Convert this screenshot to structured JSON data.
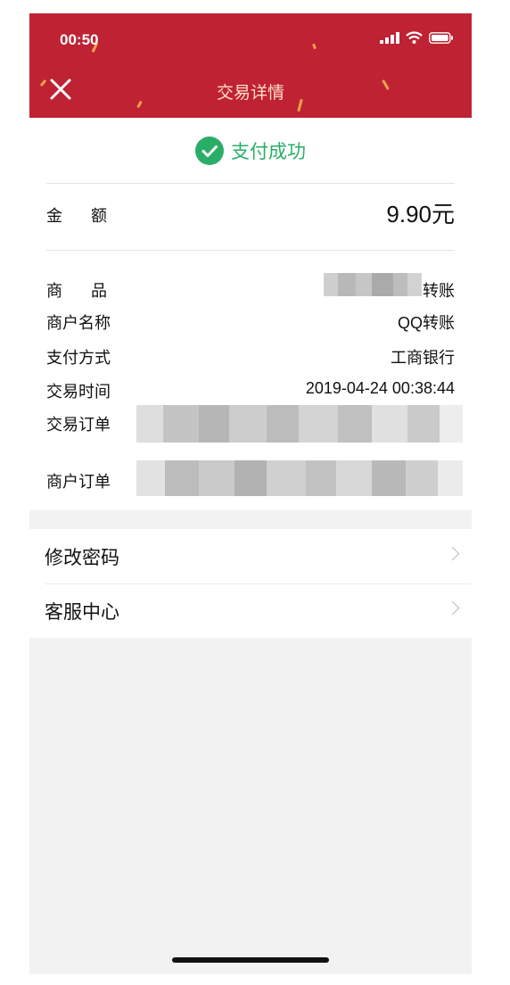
{
  "status_bar": {
    "time": "00:50"
  },
  "nav": {
    "title": "交易详情"
  },
  "status": {
    "text": "支付成功"
  },
  "amount": {
    "label": "金额",
    "value": "9.90元"
  },
  "details": {
    "product": {
      "label": "商品",
      "value": "转账"
    },
    "merchant": {
      "label": "商户名称",
      "value": "QQ转账"
    },
    "payment_method": {
      "label": "支付方式",
      "value": "工商银行"
    },
    "trade_time": {
      "label": "交易时间",
      "value": "2019-04-24 00:38:44"
    },
    "trade_order": {
      "label": "交易订单"
    },
    "merchant_order": {
      "label": "商户订单"
    }
  },
  "menu": [
    {
      "label": "修改密码"
    },
    {
      "label": "客服中心"
    }
  ],
  "colors": {
    "header": "#bf2233",
    "success": "#2aae67",
    "background": "#f2f2f2"
  }
}
